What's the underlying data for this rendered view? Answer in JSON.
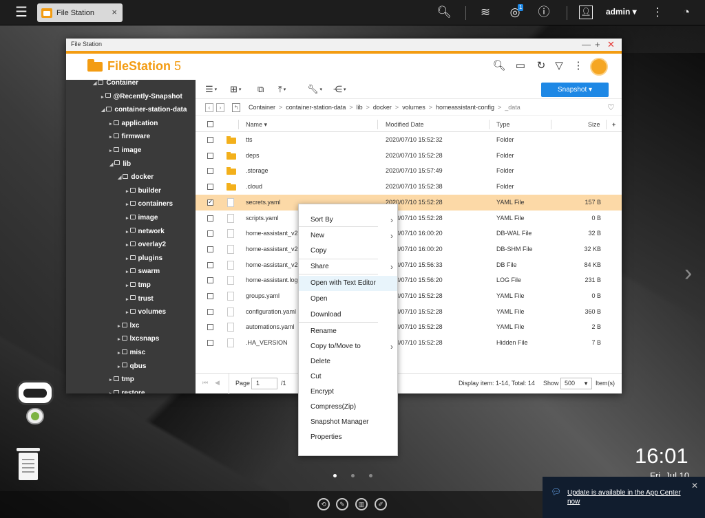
{
  "topbar": {
    "app_tab_label": "File Station",
    "app_tab_close": "×",
    "notification_count": "1",
    "user_name": "admin ▾"
  },
  "window": {
    "title": "File Station",
    "app_name_bold": "FileStation",
    "app_name_version": " 5"
  },
  "sidebar": {
    "items": [
      {
        "label": "Container",
        "level": 3,
        "expanded": true
      },
      {
        "label": "@Recently-Snapshot",
        "level": 4,
        "expanded": false
      },
      {
        "label": "container-station-data",
        "level": 4,
        "expanded": true
      },
      {
        "label": "application",
        "level": 5,
        "expanded": false
      },
      {
        "label": "firmware",
        "level": 5,
        "expanded": false
      },
      {
        "label": "image",
        "level": 5,
        "expanded": false
      },
      {
        "label": "lib",
        "level": 5,
        "expanded": true
      },
      {
        "label": "docker",
        "level": 6,
        "expanded": true
      },
      {
        "label": "builder",
        "level": 7,
        "expanded": false
      },
      {
        "label": "containers",
        "level": 7,
        "expanded": false
      },
      {
        "label": "image",
        "level": 7,
        "expanded": false
      },
      {
        "label": "network",
        "level": 7,
        "expanded": false
      },
      {
        "label": "overlay2",
        "level": 7,
        "expanded": false
      },
      {
        "label": "plugins",
        "level": 7,
        "expanded": false
      },
      {
        "label": "swarm",
        "level": 7,
        "expanded": false
      },
      {
        "label": "tmp",
        "level": 7,
        "expanded": false
      },
      {
        "label": "trust",
        "level": 7,
        "expanded": false
      },
      {
        "label": "volumes",
        "level": 7,
        "expanded": false
      },
      {
        "label": "lxc",
        "level": 6,
        "expanded": false
      },
      {
        "label": "lxcsnaps",
        "level": 6,
        "expanded": false
      },
      {
        "label": "misc",
        "level": 6,
        "expanded": false
      },
      {
        "label": "qbus",
        "level": 6,
        "expanded": false
      },
      {
        "label": "tmp",
        "level": 5,
        "expanded": false
      },
      {
        "label": "restore",
        "level": 5,
        "expanded": false
      }
    ]
  },
  "toolbar": {
    "snapshot_label": "Snapshot ▾"
  },
  "breadcrumb": {
    "path": [
      "Container",
      "container-station-data",
      "lib",
      "docker",
      "volumes",
      "homeassistant-config"
    ],
    "current": "_data"
  },
  "list": {
    "columns": {
      "name": "Name ▾",
      "modified": "Modified Date",
      "type": "Type",
      "size": "Size",
      "add": "+"
    },
    "rows": [
      {
        "name": "tts",
        "modified": "2020/07/10 15:52:32",
        "type": "Folder",
        "size": "",
        "kind": "folder",
        "selected": false
      },
      {
        "name": "deps",
        "modified": "2020/07/10 15:52:28",
        "type": "Folder",
        "size": "",
        "kind": "folder",
        "selected": false
      },
      {
        "name": ".storage",
        "modified": "2020/07/10 15:57:49",
        "type": "Folder",
        "size": "",
        "kind": "folder",
        "selected": false
      },
      {
        "name": ".cloud",
        "modified": "2020/07/10 15:52:38",
        "type": "Folder",
        "size": "",
        "kind": "folder",
        "selected": false
      },
      {
        "name": "secrets.yaml",
        "modified": "2020/07/10 15:52:28",
        "type": "YAML File",
        "size": "157 B",
        "kind": "file",
        "selected": true
      },
      {
        "name": "scripts.yaml",
        "modified": "2020/07/10 15:52:28",
        "type": "YAML File",
        "size": "0 B",
        "kind": "file",
        "selected": false
      },
      {
        "name": "home-assistant_v2",
        "modified": "2020/07/10 16:00:20",
        "type": "DB-WAL File",
        "size": "32 B",
        "kind": "file",
        "selected": false
      },
      {
        "name": "home-assistant_v2",
        "modified": "2020/07/10 16:00:20",
        "type": "DB-SHM File",
        "size": "32 KB",
        "kind": "file",
        "selected": false
      },
      {
        "name": "home-assistant_v2",
        "modified": "2020/07/10 15:56:33",
        "type": "DB File",
        "size": "84 KB",
        "kind": "file",
        "selected": false
      },
      {
        "name": "home-assistant.log",
        "modified": "2020/07/10 15:56:20",
        "type": "LOG File",
        "size": "231 B",
        "kind": "file",
        "selected": false
      },
      {
        "name": "groups.yaml",
        "modified": "2020/07/10 15:52:28",
        "type": "YAML File",
        "size": "0 B",
        "kind": "file",
        "selected": false
      },
      {
        "name": "configuration.yaml",
        "modified": "2020/07/10 15:52:28",
        "type": "YAML File",
        "size": "360 B",
        "kind": "file",
        "selected": false
      },
      {
        "name": "automations.yaml",
        "modified": "2020/07/10 15:52:28",
        "type": "YAML File",
        "size": "2 B",
        "kind": "file",
        "selected": false
      },
      {
        "name": ".HA_VERSION",
        "modified": "2020/07/10 15:52:28",
        "type": "Hidden File",
        "size": "7 B",
        "kind": "file",
        "selected": false
      }
    ]
  },
  "footer": {
    "page_label": "Page",
    "page_value": "1",
    "page_total": "/1",
    "display_info": "Display item: 1-14, Total: 14",
    "show_label": "Show",
    "show_value": "500",
    "items_label": "Item(s)"
  },
  "context_menu": {
    "items": [
      {
        "label": "Sort By",
        "submenu": true
      },
      {
        "label": "New",
        "submenu": true
      },
      {
        "label": "Copy",
        "submenu": false
      },
      {
        "label": "Share",
        "submenu": true
      },
      {
        "label": "Open with Text Editor",
        "submenu": false
      },
      {
        "label": "Open",
        "submenu": false
      },
      {
        "label": "Download",
        "submenu": false
      },
      {
        "label": "Rename",
        "submenu": false
      },
      {
        "label": "Copy to/Move to",
        "submenu": true
      },
      {
        "label": "Delete",
        "submenu": false
      },
      {
        "label": "Cut",
        "submenu": false
      },
      {
        "label": "Encrypt",
        "submenu": false
      },
      {
        "label": "Compress(Zip)",
        "submenu": false
      },
      {
        "label": "Snapshot Manager",
        "submenu": false
      },
      {
        "label": "Properties",
        "submenu": false
      }
    ]
  },
  "desktop": {
    "time": "16:01",
    "date": "Fri, Jul 10",
    "notification": "Update is available in the App Center now"
  },
  "colors": {
    "accent_orange": "#f39c12",
    "selection": "#fcd9a7",
    "snapshot_blue": "#1e88e5",
    "sidebar_bg": "#3a3a3a"
  }
}
